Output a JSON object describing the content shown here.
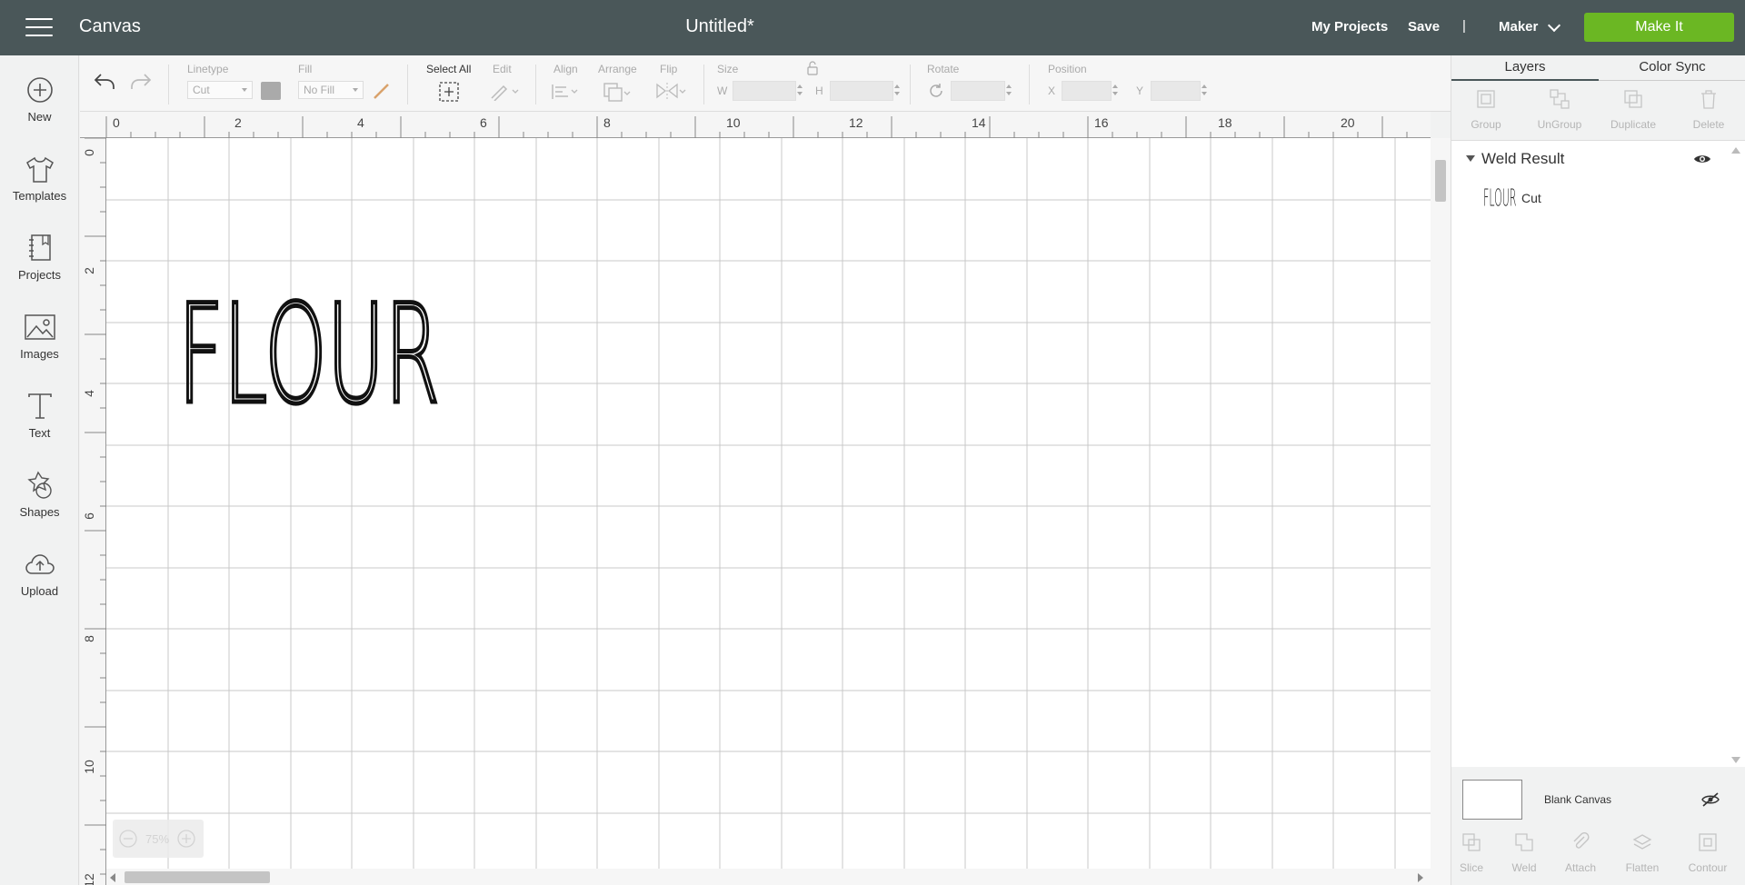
{
  "header": {
    "app_title": "Canvas",
    "doc_title": "Untitled*",
    "my_projects": "My Projects",
    "save": "Save",
    "separator": "|",
    "machine": "Maker",
    "make_it": "Make It",
    "make_it_color": "#6bb723",
    "bar_color": "#4a5759"
  },
  "sidebar": {
    "items": [
      {
        "label": "New",
        "icon": "plus-circle-icon"
      },
      {
        "label": "Templates",
        "icon": "tshirt-icon"
      },
      {
        "label": "Projects",
        "icon": "book-icon"
      },
      {
        "label": "Images",
        "icon": "image-icon"
      },
      {
        "label": "Text",
        "icon": "text-icon"
      },
      {
        "label": "Shapes",
        "icon": "shapes-icon"
      },
      {
        "label": "Upload",
        "icon": "cloud-upload-icon"
      }
    ]
  },
  "toolbar": {
    "linetype_label": "Linetype",
    "linetype_value": "Cut",
    "fill_label": "Fill",
    "fill_value": "No Fill",
    "select_all": "Select All",
    "edit": "Edit",
    "align": "Align",
    "arrange": "Arrange",
    "flip": "Flip",
    "size": "Size",
    "w": "W",
    "h": "H",
    "rotate": "Rotate",
    "position": "Position",
    "x": "X",
    "y": "Y"
  },
  "canvas": {
    "top_ruler": [
      "0",
      "2",
      "4",
      "6",
      "8",
      "10",
      "12",
      "14",
      "16",
      "18",
      "20"
    ],
    "left_ruler": [
      "0",
      "2",
      "4",
      "6",
      "8",
      "10",
      "12"
    ],
    "design_text": "FLOUR",
    "zoom": "75%"
  },
  "right_panel": {
    "tabs": [
      "Layers",
      "Color Sync"
    ],
    "tools": [
      "Group",
      "UnGroup",
      "Duplicate",
      "Delete"
    ],
    "layer_group": "Weld Result",
    "layer_thumb_text": "FLOUR",
    "layer_item_type": "Cut",
    "blank_canvas": "Blank Canvas",
    "bottom_tools": [
      "Slice",
      "Weld",
      "Attach",
      "Flatten",
      "Contour"
    ]
  }
}
